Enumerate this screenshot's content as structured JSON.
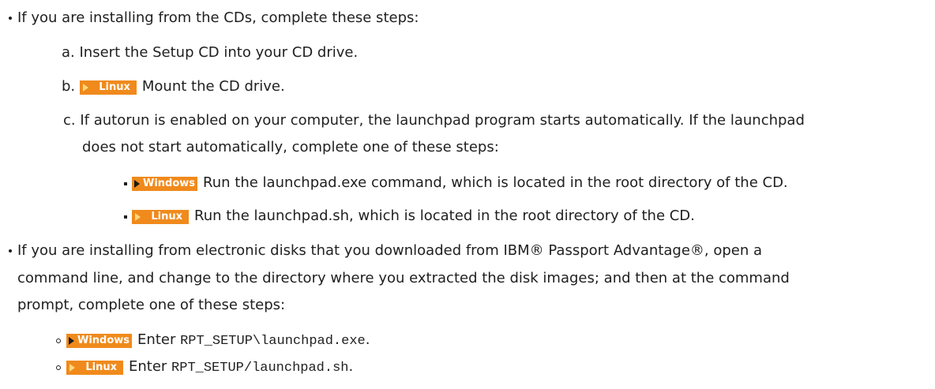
{
  "colors": {
    "text": "#1f1f1f",
    "badge_bg": "#f08a1c",
    "badge_text": "#ffffff"
  },
  "icons": {
    "linux_badge": "linux-platform-badge",
    "windows_badge": "windows-platform-badge"
  },
  "cd_install": {
    "intro": "If you are installing from the CDs, complete these steps:",
    "step_a": {
      "marker": "a.",
      "text": "Insert the Setup CD into your CD drive."
    },
    "step_b": {
      "marker": "b.",
      "badge": "Linux",
      "text": "Mount the CD drive."
    },
    "step_c": {
      "marker": "c.",
      "line1": "If autorun is enabled on your computer, the launchpad program starts automatically. If the launchpad",
      "line2": "does not start automatically, complete one of these steps:",
      "options": [
        {
          "badge": "Windows",
          "text": "Run the launchpad.exe command, which is located in the root directory of the CD."
        },
        {
          "badge": "Linux",
          "text": "Run the launchpad.sh, which is located in the root directory of the CD."
        }
      ]
    }
  },
  "electronic_install": {
    "line1": "If you are installing from electronic disks that you downloaded from IBM® Passport Advantage®, open a",
    "line2": "command line, and change to the directory where you extracted the disk images; and then at the command",
    "line3": "prompt, complete one of these steps:",
    "options": [
      {
        "badge": "Windows",
        "prefix": "Enter ",
        "code": "RPT_SETUP\\launchpad.exe",
        "suffix": "."
      },
      {
        "badge": "Linux",
        "prefix": "Enter ",
        "code": "RPT_SETUP/launchpad.sh",
        "suffix": "."
      }
    ]
  }
}
